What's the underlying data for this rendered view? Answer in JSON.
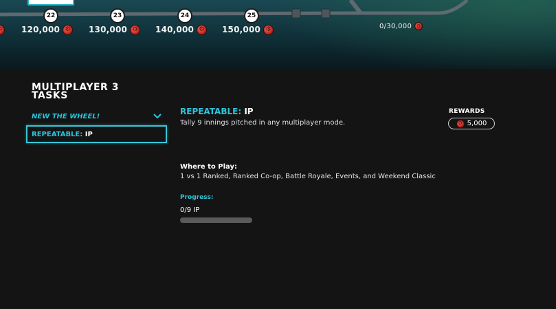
{
  "track": {
    "nodes": [
      {
        "number": "22",
        "reward": "120,000"
      },
      {
        "number": "23",
        "reward": "130,000"
      },
      {
        "number": "24",
        "reward": "140,000"
      },
      {
        "number": "25",
        "reward": "150,000"
      }
    ],
    "total_progress": "0/30,000",
    "colors": {
      "node_fill": "#ffffff",
      "coin": "#c8231c",
      "accent": "#2cc6dc"
    }
  },
  "program": {
    "title": "MULTIPLAYER 3 TASKS"
  },
  "task_list": {
    "group_label": "NEW THE WHEEL!",
    "selected_item": {
      "prefix": "REPEATABLE:",
      "name": "IP"
    }
  },
  "task_detail": {
    "title_prefix": "REPEATABLE:",
    "title_name": "IP",
    "description": "Tally 9 innings pitched in any multiplayer mode.",
    "rewards_label": "REWARDS",
    "reward_amount": "5,000",
    "where_label": "Where to Play:",
    "where_value": "1 vs 1 Ranked, Ranked Co-op, Battle Royale, Events, and Weekend Classic",
    "progress_label": "Progress:",
    "progress_value": "0/9 IP",
    "progress_fraction": 0
  },
  "icons": {
    "coin": "stubs-coin-icon",
    "chevron": "chevron-down-icon"
  }
}
